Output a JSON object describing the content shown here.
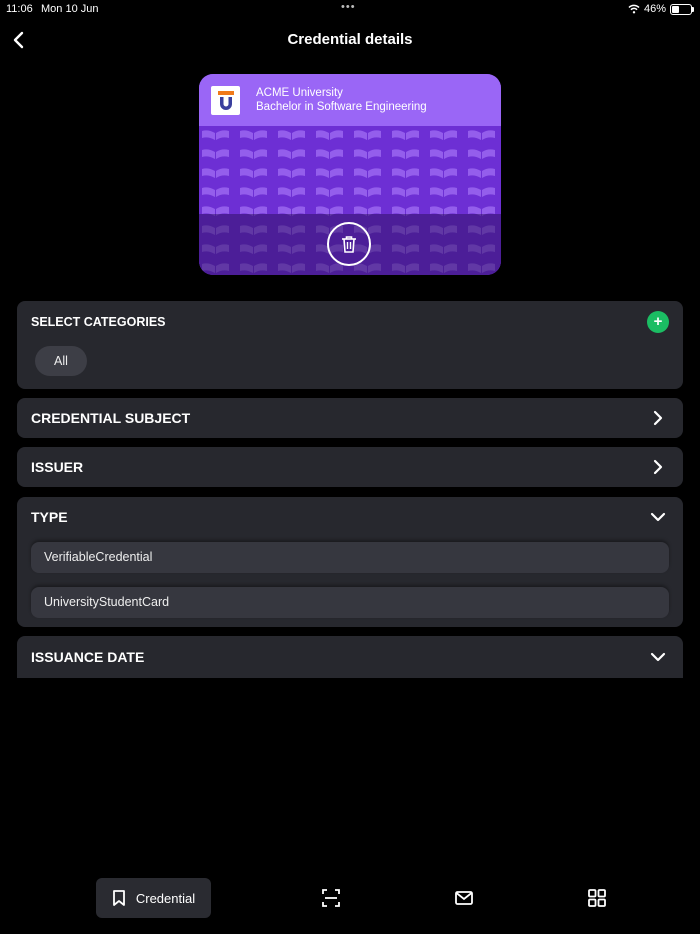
{
  "status_bar": {
    "time": "11:06",
    "date": "Mon 10 Jun",
    "dots": "•••",
    "battery": "46%"
  },
  "header": {
    "title": "Credential details"
  },
  "card": {
    "issuer": "ACME University",
    "name": "Bachelor in Software Engineering",
    "accent": "#9a66f6"
  },
  "categories": {
    "label": "SELECT CATEGORIES",
    "add": "+",
    "chips": [
      "All"
    ]
  },
  "sections": {
    "subject": "CREDENTIAL SUBJECT",
    "issuer": "ISSUER",
    "type": "TYPE",
    "type_items": [
      "VerifiableCredential",
      "UniversityStudentCard"
    ],
    "issuance_date": "ISSUANCE DATE"
  },
  "tabbar": {
    "active_label": "Credential",
    "icons": [
      "bookmark-icon",
      "scan-icon",
      "mail-icon",
      "grid-icon"
    ]
  }
}
